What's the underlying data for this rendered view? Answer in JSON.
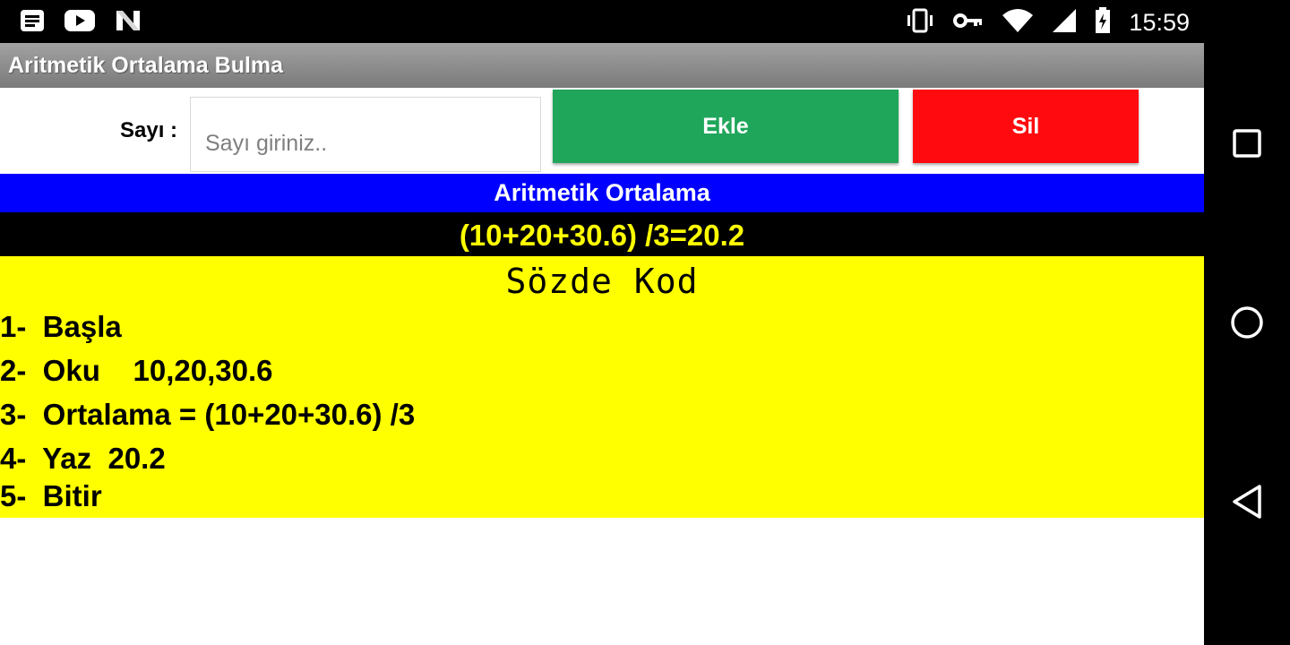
{
  "status_bar": {
    "time": "15:59",
    "left_icons": [
      "notes-icon",
      "youtube-icon",
      "n-logo-icon"
    ],
    "right_icons": [
      "vibrate-icon",
      "key-icon",
      "wifi-icon",
      "signal-icon",
      "battery-charging-icon"
    ]
  },
  "app": {
    "title": "Aritmetik Ortalama Bulma",
    "input_label": "Sayı :",
    "input_placeholder": "Sayı giriniz..",
    "input_value": "",
    "add_button": "Ekle",
    "delete_button": "Sil",
    "heading": "Aritmetik Ortalama",
    "formula_result": "(10+20+30.6) /3=20.2",
    "pseudo_title": "Sözde  Kod",
    "steps": [
      "1-  Başla",
      "2-  Oku    10,20,30.6",
      "3-  Ortalama = (10+20+30.6) /3",
      "4-  Yaz  20.2",
      "5-  Bitir"
    ]
  },
  "colors": {
    "add_button": "#1fa65a",
    "delete_button": "#ff0b0f",
    "heading_bg": "#0000ff",
    "result_text": "#ffff00",
    "panel_bg": "#ffff00"
  },
  "nav_bar": {
    "buttons": [
      "recents-square-icon",
      "home-circle-icon",
      "back-triangle-icon"
    ]
  }
}
